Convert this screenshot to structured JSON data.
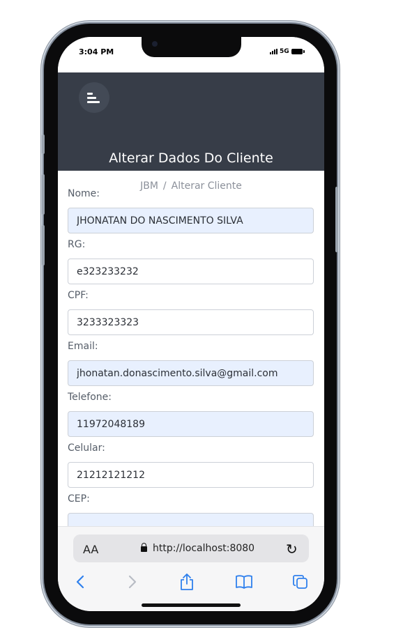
{
  "status_bar": {
    "time": "3:04 PM",
    "network": "5G"
  },
  "header": {
    "title": "Alterar Dados Do Cliente",
    "breadcrumb": {
      "home": "JBM",
      "separator": "/",
      "current": "Alterar Cliente"
    }
  },
  "form": {
    "nome": {
      "label": "Nome:",
      "value": "JHONATAN DO NASCIMENTO SILVA"
    },
    "rg": {
      "label": "RG:",
      "value": "e323233232"
    },
    "cpf": {
      "label": "CPF:",
      "value": "3233323323"
    },
    "email": {
      "label": "Email:",
      "value": "jhonatan.donascimento.silva@gmail.com"
    },
    "telefone": {
      "label": "Telefone:",
      "value": "11972048189"
    },
    "celular": {
      "label": "Celular:",
      "value": "21212121212"
    },
    "cep": {
      "label": "CEP:",
      "value": ""
    }
  },
  "browser": {
    "text_size_label": "AA",
    "url": "http://localhost:8080"
  },
  "icons": {
    "menu": "menu-icon",
    "lock": "lock-icon",
    "reload": "reload-icon",
    "back": "chevron-left-icon",
    "forward": "chevron-right-icon",
    "share": "share-icon",
    "bookmarks": "book-icon",
    "tabs": "tabs-icon"
  },
  "colors": {
    "header_bg": "#373d48",
    "accent": "#2f80ed",
    "autofill_bg": "#e8f0fe"
  }
}
